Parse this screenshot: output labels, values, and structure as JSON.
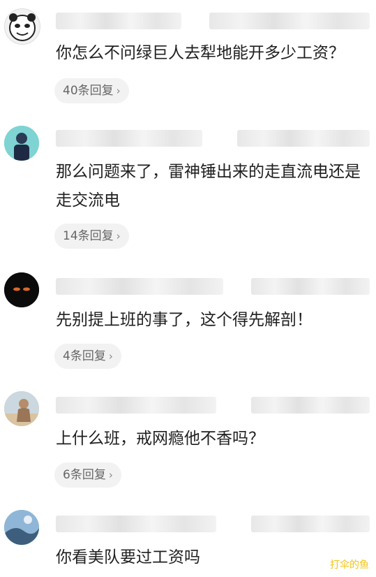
{
  "comments": [
    {
      "text": "你怎么不问绿巨人去犁地能开多少工资？",
      "reply_label": "40条回复",
      "chevron": "›"
    },
    {
      "text": "那么问题来了，雷神锤出来的走直流电还是走交流电",
      "reply_label": "14条回复",
      "chevron": "›"
    },
    {
      "text": "先别提上班的事了，这个得先解剖！",
      "reply_label": "4条回复",
      "chevron": "›"
    },
    {
      "text": "上什么班，戒网瘾他不香吗？",
      "reply_label": "6条回复",
      "chevron": "›"
    },
    {
      "text": "你看美队要过工资吗"
    }
  ],
  "watermark": "打伞的鱼"
}
